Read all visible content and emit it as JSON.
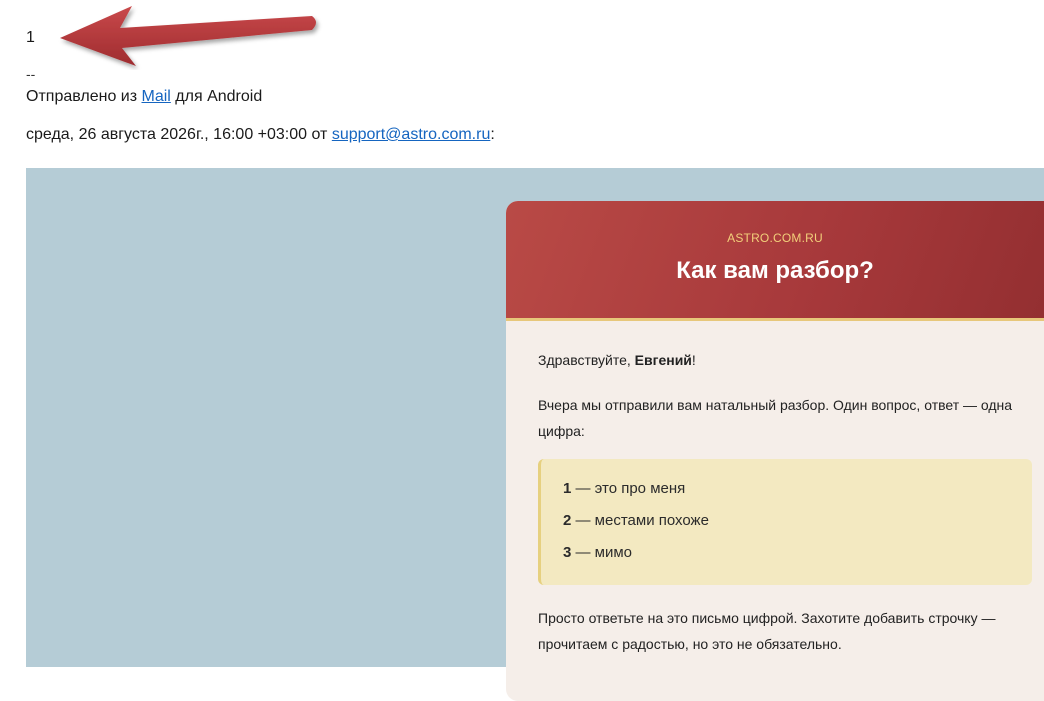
{
  "reply": {
    "text": "1"
  },
  "signature": {
    "separator": "--",
    "prefix": "Отправлено из ",
    "app_link": "Mail",
    "suffix": " для Android"
  },
  "quote_header": {
    "date_text": "среда, 26 августа 2026г., 16:00 +03:00 от ",
    "sender_email": "support@astro.com.ru",
    "trailing": ":"
  },
  "email": {
    "brand": "ASTRO.COM.RU",
    "title": "Как вам разбор?",
    "greeting_prefix": "Здравствуйте, ",
    "greeting_name": "Евгений",
    "greeting_suffix": "!",
    "intro": "Вчера мы отправили вам натальный разбор. Один вопрос, ответ — одна цифра:",
    "options": [
      {
        "num": "1",
        "text": " — это про меня"
      },
      {
        "num": "2",
        "text": " — местами похоже"
      },
      {
        "num": "3",
        "text": " — мимо"
      }
    ],
    "outro": "Просто ответьте на это письмо цифрой. Захотите добавить строчку — прочитаем с радостью, но это не обязательно."
  },
  "colors": {
    "header_red": "#a7393b",
    "brand_gold": "#f2cf7a",
    "page_blue": "#b5ccd6",
    "card_bg": "#f5eee9",
    "options_bg": "#f3e9c1",
    "arrow": "#b5373a"
  },
  "icons": {
    "pointer": "arrow-annotation-icon"
  }
}
